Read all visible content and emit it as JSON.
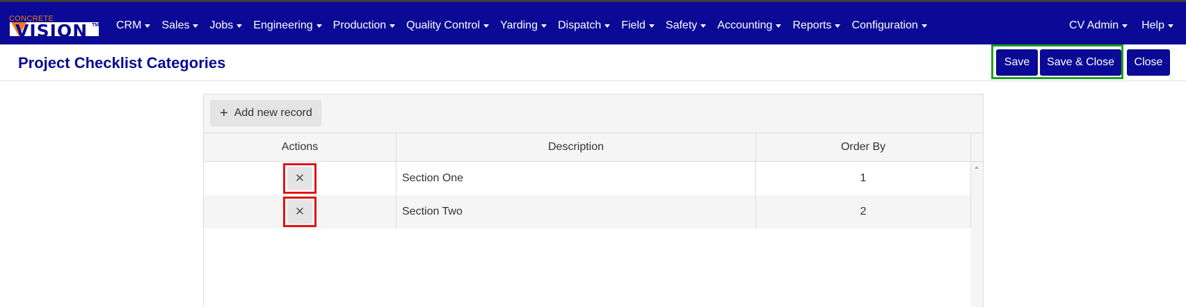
{
  "logo": {
    "top_text": "CONCRETE",
    "main_text": "VISION",
    "tm": "TM"
  },
  "nav": {
    "items": [
      {
        "label": "CRM"
      },
      {
        "label": "Sales"
      },
      {
        "label": "Jobs"
      },
      {
        "label": "Engineering"
      },
      {
        "label": "Production"
      },
      {
        "label": "Quality Control"
      },
      {
        "label": "Yarding"
      },
      {
        "label": "Dispatch"
      },
      {
        "label": "Field"
      },
      {
        "label": "Safety"
      },
      {
        "label": "Accounting"
      },
      {
        "label": "Reports"
      },
      {
        "label": "Configuration"
      }
    ],
    "right": [
      {
        "label": "CV Admin"
      },
      {
        "label": "Help"
      }
    ]
  },
  "page": {
    "title": "Project Checklist Categories"
  },
  "buttons": {
    "save": "Save",
    "save_close": "Save & Close",
    "close": "Close"
  },
  "grid": {
    "add_label": "Add new record",
    "add_icon": "+",
    "delete_icon": "✕",
    "columns": [
      "Actions",
      "Description",
      "Order By"
    ],
    "rows": [
      {
        "description": "Section One",
        "order_by": "1"
      },
      {
        "description": "Section Two",
        "order_by": "2"
      }
    ]
  },
  "colors": {
    "brand_blue": "#0a0a96",
    "brand_orange": "#f07a1a",
    "highlight_green": "#1fa01f",
    "highlight_red": "#e01616"
  }
}
